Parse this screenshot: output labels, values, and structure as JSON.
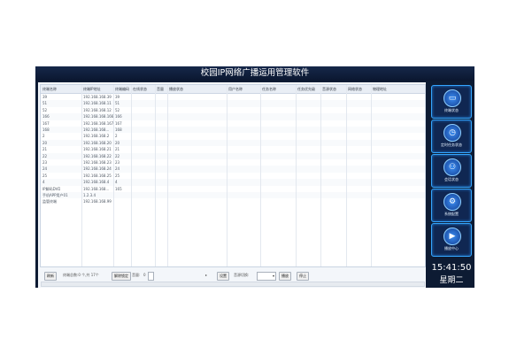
{
  "window": {
    "title": "校园IP网络广播运用管理软件"
  },
  "table": {
    "columns": [
      "终端名称",
      "终端IP地址",
      "终端编码",
      "在线状态",
      "音量",
      "播放状态",
      "用户名称",
      "任务名称",
      "任务优先级",
      "音源状态",
      "网络状态",
      "物理地址"
    ],
    "rows": [
      [
        "39",
        "192.168.168.39",
        "39"
      ],
      [
        "51",
        "192.168.168.11",
        "51"
      ],
      [
        "52",
        "192.168.168.12",
        "52"
      ],
      [
        "166",
        "192.168.168.166",
        "166"
      ],
      [
        "167",
        "192.168.168.167",
        "167"
      ],
      [
        "168",
        "192.168.168...",
        "168"
      ],
      [
        "2",
        "192.168.168.2",
        "2"
      ],
      [
        "20",
        "192.168.168.20",
        "20"
      ],
      [
        "21",
        "192.168.168.21",
        "21"
      ],
      [
        "22",
        "192.168.168.22",
        "22"
      ],
      [
        "23",
        "192.168.168.23",
        "23"
      ],
      [
        "24",
        "192.168.168.24",
        "24"
      ],
      [
        "25",
        "192.168.168.25",
        "25"
      ],
      [
        "4",
        "192.168.168.4",
        "4"
      ],
      [
        "IP解码DVD",
        "192.168.168...",
        "165"
      ],
      [
        "手机APP用户01",
        "1.2.3.4",
        ""
      ],
      [
        "监管终端",
        "192.168.168.99",
        ""
      ]
    ]
  },
  "footer": {
    "refresh_label": "刷新",
    "status_text": "终端总数:0 个,共 17个",
    "unlock_label": "解除锁定",
    "volume_label": "音量:",
    "volume_value": "0",
    "set_label": "设置",
    "audio_label": "音源切换:",
    "play_label": "播放",
    "stop_label": "停止"
  },
  "nav": [
    {
      "label": "终端状态",
      "icon": "monitor-icon",
      "glyph": "▭"
    },
    {
      "label": "定时任务状态",
      "icon": "clock-icon",
      "glyph": "◷"
    },
    {
      "label": "会话状态",
      "icon": "people-icon",
      "glyph": "⚇"
    },
    {
      "label": "系统配置",
      "icon": "settings-icon",
      "glyph": "⚙"
    },
    {
      "label": "播放中心",
      "icon": "play-icon",
      "glyph": "▶"
    }
  ],
  "clock": {
    "time": "15:41:50",
    "weekday": "星期二"
  },
  "colors": {
    "app_bg": "#0d1b33",
    "nav_border": "#35a6ff",
    "nav_icon": "#3a8cf0"
  }
}
